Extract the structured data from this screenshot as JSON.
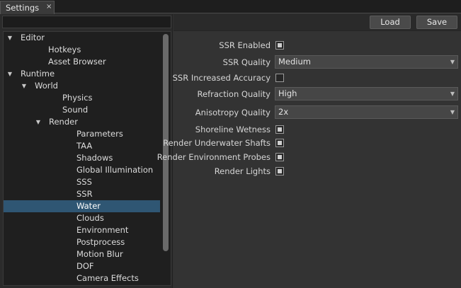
{
  "tab": {
    "title": "Settings",
    "close": "×"
  },
  "search": {
    "value": "",
    "placeholder": ""
  },
  "tree": {
    "items": [
      {
        "label": "Editor",
        "level": 0,
        "expandable": true,
        "expanded": true
      },
      {
        "label": "Hotkeys",
        "level": 1,
        "expandable": false
      },
      {
        "label": "Asset Browser",
        "level": 1,
        "expandable": false
      },
      {
        "label": "Runtime",
        "level": 0,
        "expandable": true,
        "expanded": true
      },
      {
        "label": "World",
        "level": 1,
        "expandable": true,
        "expanded": true
      },
      {
        "label": "Physics",
        "level": 2,
        "expandable": false
      },
      {
        "label": "Sound",
        "level": 2,
        "expandable": false
      },
      {
        "label": "Render",
        "level": 2,
        "expandable": true,
        "expanded": true
      },
      {
        "label": "Parameters",
        "level": 3,
        "expandable": false
      },
      {
        "label": "TAA",
        "level": 3,
        "expandable": false
      },
      {
        "label": "Shadows",
        "level": 3,
        "expandable": false
      },
      {
        "label": "Global Illumination",
        "level": 3,
        "expandable": false
      },
      {
        "label": "SSS",
        "level": 3,
        "expandable": false
      },
      {
        "label": "SSR",
        "level": 3,
        "expandable": false
      },
      {
        "label": "Water",
        "level": 3,
        "expandable": false,
        "selected": true
      },
      {
        "label": "Clouds",
        "level": 3,
        "expandable": false
      },
      {
        "label": "Environment",
        "level": 3,
        "expandable": false
      },
      {
        "label": "Postprocess",
        "level": 3,
        "expandable": false
      },
      {
        "label": "Motion Blur",
        "level": 3,
        "expandable": false
      },
      {
        "label": "DOF",
        "level": 3,
        "expandable": false
      },
      {
        "label": "Camera Effects",
        "level": 3,
        "expandable": false
      }
    ]
  },
  "toolbar": {
    "load_label": "Load",
    "save_label": "Save"
  },
  "settings": [
    {
      "label": "SSR Enabled",
      "type": "checkbox",
      "checked": true
    },
    {
      "label": "SSR Quality",
      "type": "select",
      "value": "Medium"
    },
    {
      "label": "SSR Increased Accuracy",
      "type": "checkbox",
      "checked": false
    },
    {
      "label": "Refraction Quality",
      "type": "select",
      "value": "High"
    },
    {
      "label": "Anisotropy Quality",
      "type": "select",
      "value": "2x"
    },
    {
      "label": "Shoreline Wetness",
      "type": "checkbox",
      "checked": true
    },
    {
      "label": "Render Underwater Shafts",
      "type": "checkbox",
      "checked": true
    },
    {
      "label": "Render Environment Probes",
      "type": "checkbox",
      "checked": true
    },
    {
      "label": "Render Lights",
      "type": "checkbox",
      "checked": true
    }
  ],
  "icons": {
    "tree_expanded": "caret-down-icon",
    "select_dropdown": "chevron-down-icon",
    "tab_close": "close-icon"
  },
  "colors": {
    "selection": "#2f5673",
    "background": "#323232"
  }
}
